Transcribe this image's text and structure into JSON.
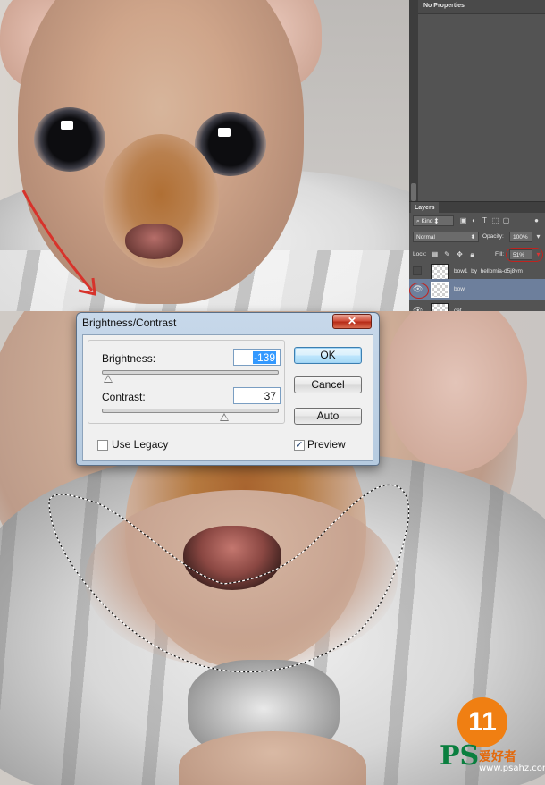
{
  "layers_panel": {
    "properties_title": "No Properties",
    "tab_label": "Layers",
    "kind_filter": "Kind",
    "blend_mode": "Normal",
    "opacity_label": "Opacity:",
    "opacity_value": "100%",
    "lock_label": "Lock:",
    "fill_label": "Fill:",
    "fill_value": "51%",
    "layers": [
      {
        "name": "bow1_by_hellomia-d5j8vm",
        "visible": false,
        "selected": false
      },
      {
        "name": "bow",
        "visible": true,
        "selected": true
      },
      {
        "name": "cat",
        "visible": true,
        "selected": false
      }
    ]
  },
  "dialog": {
    "title": "Brightness/Contrast",
    "close_glyph": "✕",
    "brightness_label": "Brightness:",
    "brightness_value": "-139",
    "contrast_label": "Contrast:",
    "contrast_value": "37",
    "ok_label": "OK",
    "cancel_label": "Cancel",
    "auto_label": "Auto",
    "use_legacy_label": "Use Legacy",
    "use_legacy_checked": false,
    "preview_label": "Preview",
    "preview_checked": true
  },
  "watermark": {
    "badge_number": "11",
    "brand": "PS",
    "brand_cn": "爱好者",
    "url": "www.psahz.com"
  },
  "colors": {
    "highlight_red": "#c0231f",
    "selected_layer": "#6d7f9c",
    "panel_bg": "#535353"
  }
}
